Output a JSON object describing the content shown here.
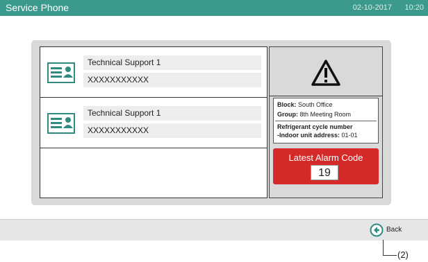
{
  "header": {
    "title": "Service Phone",
    "date": "02-10-2017",
    "time": "10:20"
  },
  "contacts": [
    {
      "name": "Technical Support 1",
      "phone": "XXXXXXXXXXX",
      "icon": "contact-card-icon"
    },
    {
      "name": "Technical Support 1",
      "phone": "XXXXXXXXXXX",
      "icon": "contact-card-icon"
    }
  ],
  "alarm": {
    "icon": "warning-icon",
    "block_label": "Block:",
    "block_value": "South Office",
    "group_label": "Group:",
    "group_value": "8th Meeting Room",
    "refrigerant_label": "Refrigerant cycle number",
    "indoor_label": "-Indoor unit address:",
    "indoor_value": "01-01",
    "latest_label": "Latest Alarm Code",
    "latest_code": "19"
  },
  "footer": {
    "back_label": "Back",
    "back_icon": "back-arrow-icon"
  },
  "annotation": {
    "label": "(2)"
  },
  "colors": {
    "header": "#3c9a8d",
    "alarm": "#d62a2a",
    "frame": "#d9d9d9"
  }
}
